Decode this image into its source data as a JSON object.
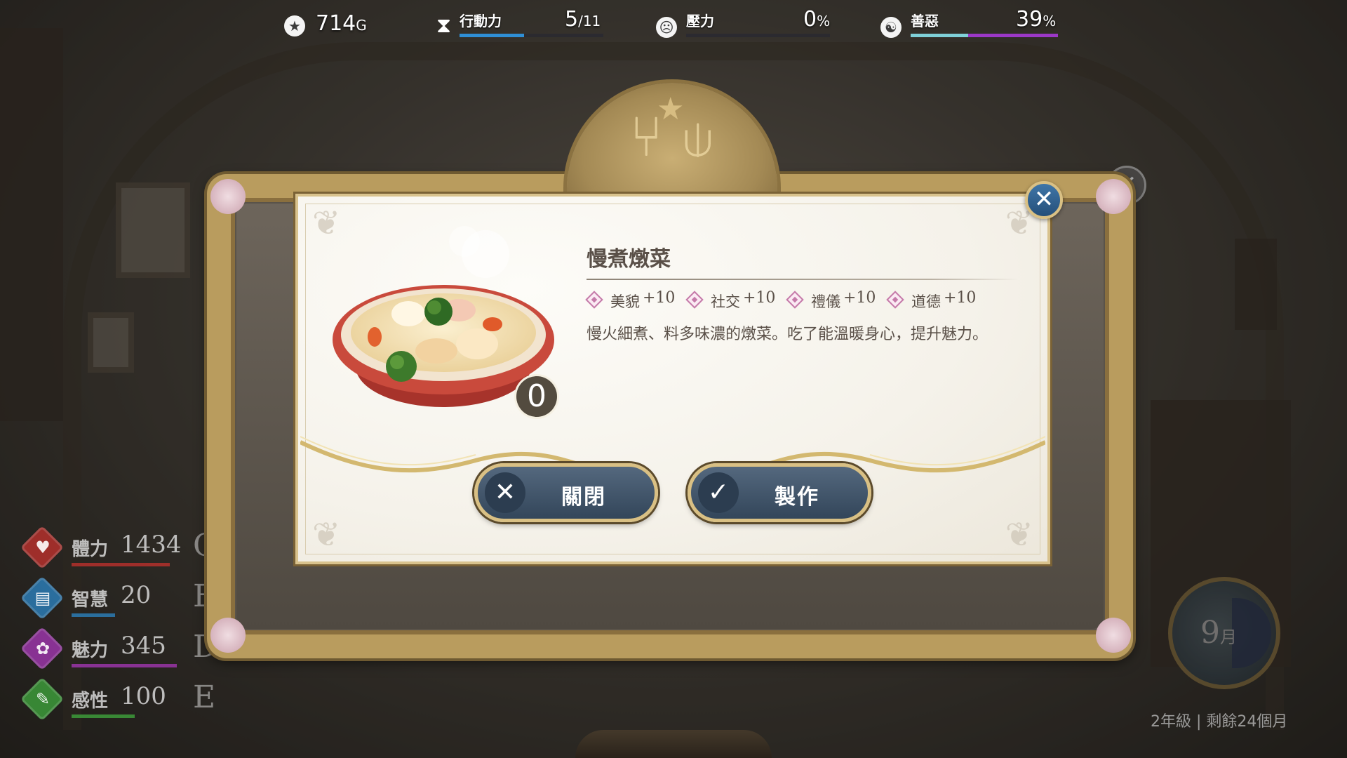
{
  "hud": {
    "money": {
      "value": "714",
      "unit": "G",
      "icon": "star-coin-icon"
    },
    "action": {
      "label": "行動力",
      "value": "5",
      "max": "/11",
      "icon": "hourglass-icon",
      "fill": 0.45,
      "color": "#2f8fd6"
    },
    "stress": {
      "label": "壓力",
      "value": "0",
      "unit": "%",
      "icon": "stress-face-icon",
      "fill": 0.0,
      "color": "#2f8fd6"
    },
    "morality": {
      "label": "善惡",
      "value": "39",
      "unit": "%",
      "icon": "good-evil-icon",
      "fill": 0.39,
      "color_good": "#7fd0d8",
      "color_evil": "#9b38c7"
    }
  },
  "left_stats": [
    {
      "name": "體力",
      "value": "1434",
      "grade": "C",
      "color": "#b3302c",
      "icon": "heart-icon"
    },
    {
      "name": "智慧",
      "value": "20",
      "grade": "E",
      "color": "#2b7bb4",
      "icon": "book-icon"
    },
    {
      "name": "魅力",
      "value": "345",
      "grade": "D",
      "color": "#9a35a8",
      "icon": "rose-icon"
    },
    {
      "name": "感性",
      "value": "100",
      "grade": "E",
      "color": "#3d9a3a",
      "icon": "brush-icon"
    }
  ],
  "month": {
    "number": "9",
    "unit": "月"
  },
  "school_year": "2年級 | 剩餘24個月",
  "dialog": {
    "title": "慢煮燉菜",
    "count": "0",
    "effects": [
      {
        "name": "美貌",
        "value": "+10"
      },
      {
        "name": "社交",
        "value": "+10"
      },
      {
        "name": "禮儀",
        "value": "+10"
      },
      {
        "name": "道德",
        "value": "+10"
      }
    ],
    "description": "慢火細煮、料多味濃的燉菜。吃了能溫暖身心，提升魅力。",
    "close_label": "關閉",
    "make_label": "製作"
  }
}
